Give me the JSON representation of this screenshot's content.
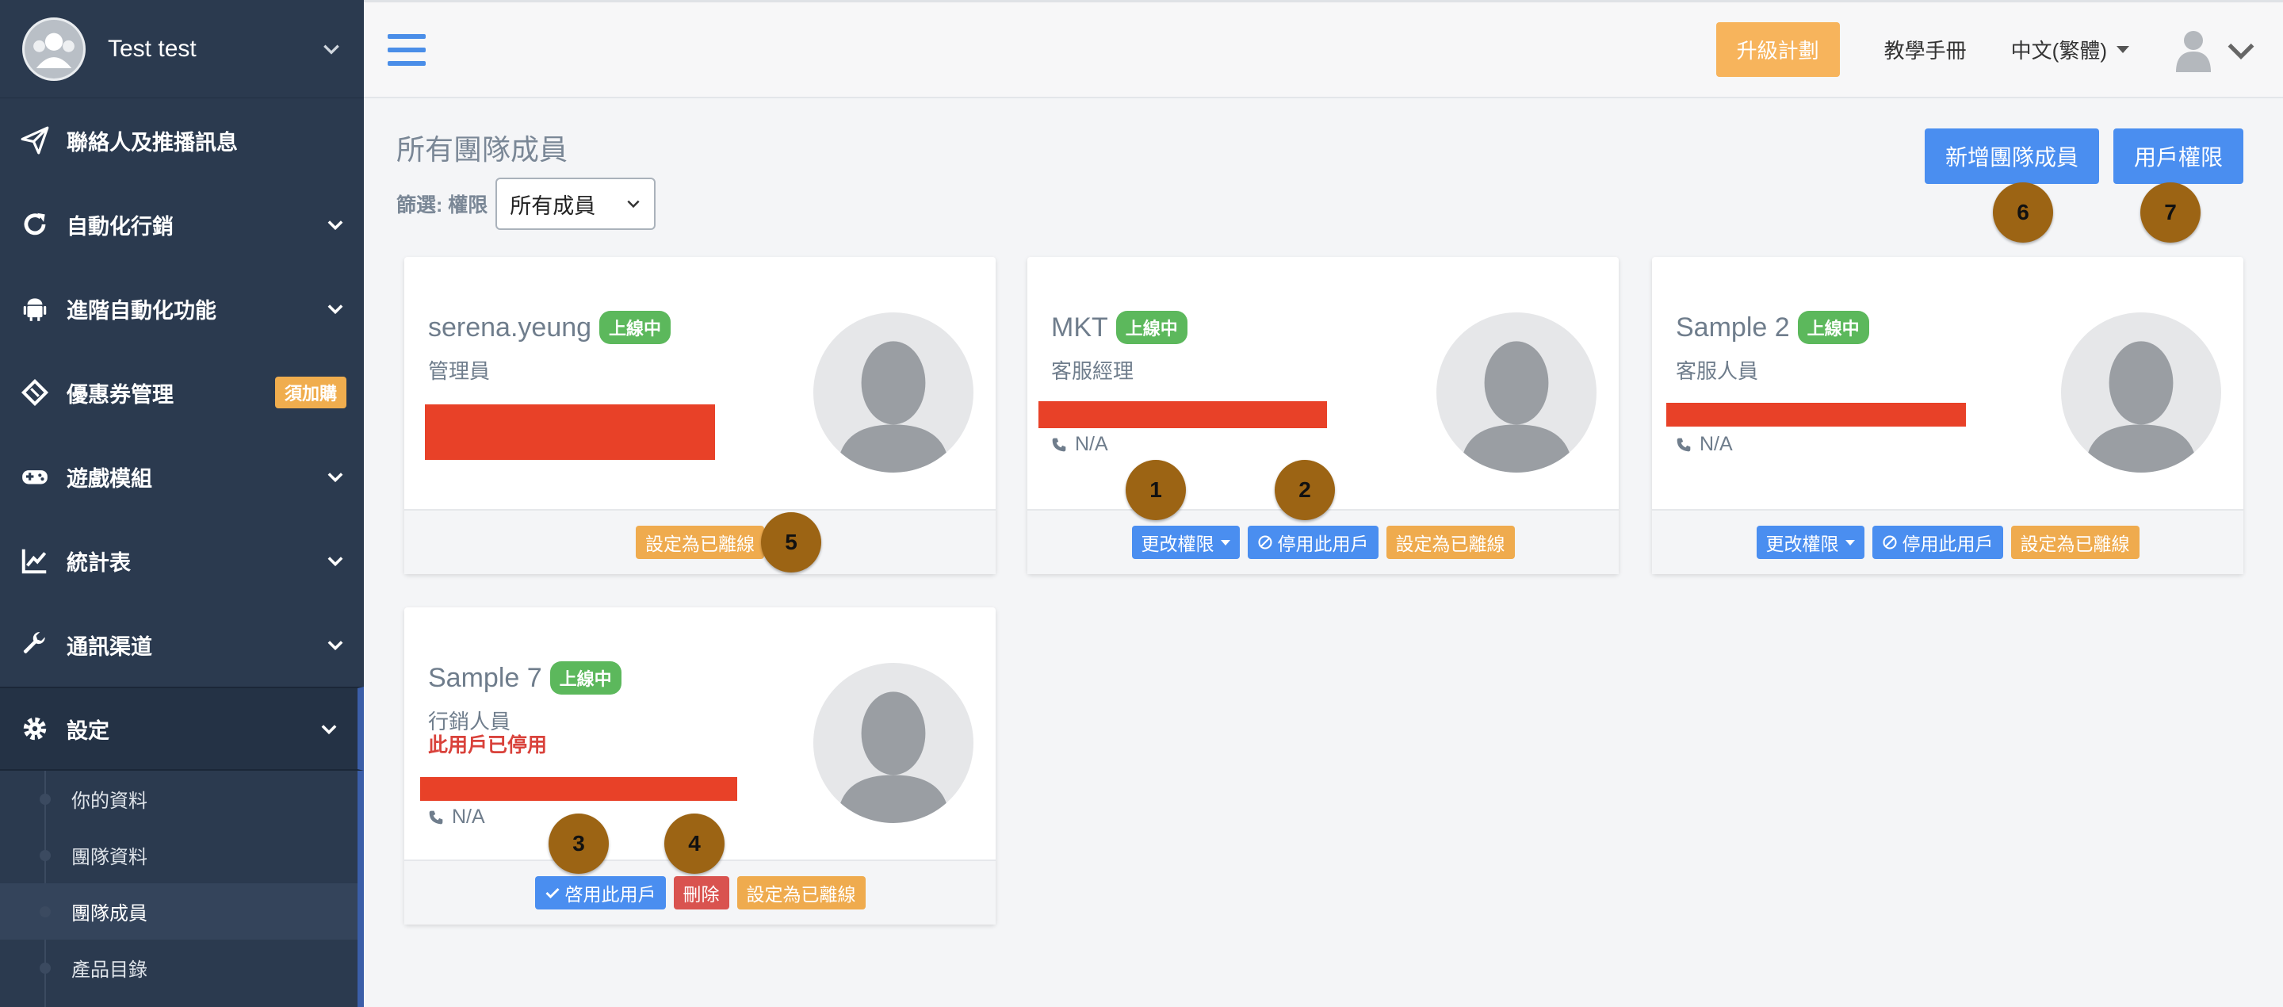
{
  "sidebar": {
    "user_name": "Test test",
    "items": [
      {
        "label": "聯絡人及推播訊息",
        "icon": "paper-plane-icon"
      },
      {
        "label": "自動化行銷",
        "icon": "refresh-icon"
      },
      {
        "label": "進階自動化功能",
        "icon": "android-icon"
      },
      {
        "label": "優惠券管理",
        "icon": "ticket-icon",
        "badge": "須加購"
      },
      {
        "label": "遊戲模組",
        "icon": "gamepad-icon"
      },
      {
        "label": "統計表",
        "icon": "line-chart-icon"
      },
      {
        "label": "通訊渠道",
        "icon": "wrench-icon"
      },
      {
        "label": "設定",
        "icon": "gear-icon"
      }
    ],
    "submenu": [
      {
        "label": "你的資料"
      },
      {
        "label": "團隊資料"
      },
      {
        "label": "團隊成員"
      },
      {
        "label": "產品目錄"
      }
    ]
  },
  "topbar": {
    "upgrade": "升級計劃",
    "manual": "教學手冊",
    "language": "中文(繁體)"
  },
  "main": {
    "title": "所有團隊成員",
    "filter_label": "篩選: 權限",
    "filter_value": "所有成員",
    "add_member": "新增團隊成員",
    "user_permissions": "用戶權限"
  },
  "members": [
    {
      "name": "serena.yeung",
      "status": "上線中",
      "role": "管理員"
    },
    {
      "name": "MKT",
      "status": "上線中",
      "role": "客服經理",
      "phone": "N/A"
    },
    {
      "name": "Sample 2",
      "status": "上線中",
      "role": "客服人員",
      "phone": "N/A"
    },
    {
      "name": "Sample 7",
      "status": "上線中",
      "role": "行銷人員",
      "disabled": "此用戶已停用",
      "phone": "N/A"
    }
  ],
  "actions": {
    "change_permission": "更改權限",
    "disable_user": "停用此用戶",
    "set_offline": "設定為已離線",
    "enable_user": "啓用此用戶",
    "delete": "刪除"
  },
  "markers": [
    "1",
    "2",
    "3",
    "4",
    "5",
    "6",
    "7"
  ]
}
